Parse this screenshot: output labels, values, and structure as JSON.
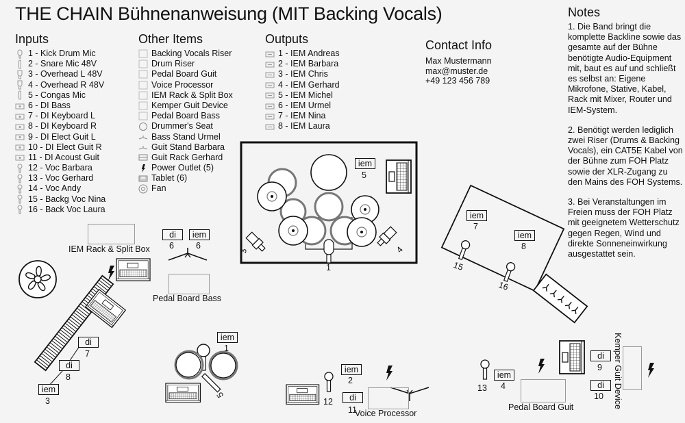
{
  "title": "THE CHAIN Bühnenanweisung (MIT Backing Vocals)",
  "inputs": {
    "heading": "Inputs",
    "items": [
      {
        "label": "1 - Kick Drum Mic",
        "icon": "kick-mic-icon"
      },
      {
        "label": "2 - Snare Mic 48V",
        "icon": "stick-mic-icon"
      },
      {
        "label": "3 - Overhead L 48V",
        "icon": "condenser-mic-icon"
      },
      {
        "label": "4 - Overhead R 48V",
        "icon": "condenser-mic-icon"
      },
      {
        "label": "5 - Congas Mic",
        "icon": "stick-mic-icon"
      },
      {
        "label": "6 - DI Bass",
        "icon": "di-box-icon"
      },
      {
        "label": "7 - DI Keyboard L",
        "icon": "di-box-icon"
      },
      {
        "label": "8 - DI Keyboard R",
        "icon": "di-box-icon"
      },
      {
        "label": "9 - DI Elect Guit L",
        "icon": "di-box-icon"
      },
      {
        "label": "10 - DI Elect Guit R",
        "icon": "di-box-icon"
      },
      {
        "label": "11 - DI Acoust Guit",
        "icon": "di-box-icon"
      },
      {
        "label": "12 - Voc Barbara",
        "icon": "vocal-mic-icon"
      },
      {
        "label": "13 - Voc Gerhard",
        "icon": "vocal-mic-icon"
      },
      {
        "label": "14 - Voc Andy",
        "icon": "vocal-mic-icon"
      },
      {
        "label": "15 - Backg Voc Nina",
        "icon": "vocal-mic-icon"
      },
      {
        "label": "16 - Back Voc Laura",
        "icon": "vocal-mic-icon"
      }
    ]
  },
  "other_items": {
    "heading": "Other Items",
    "items": [
      {
        "label": "Backing Vocals Riser",
        "icon": "riser-icon"
      },
      {
        "label": "Drum Riser",
        "icon": "riser-icon"
      },
      {
        "label": "Pedal Board Guit",
        "icon": "pedal-board-icon"
      },
      {
        "label": "Voice Processor",
        "icon": "processor-icon"
      },
      {
        "label": "IEM Rack & Split Box",
        "icon": "rack-icon"
      },
      {
        "label": "Kemper Guit Device",
        "icon": "kemper-icon"
      },
      {
        "label": "Pedal Board Bass",
        "icon": "pedal-board-icon"
      },
      {
        "label": "Drummer's Seat",
        "icon": "seat-icon"
      },
      {
        "label": "Bass Stand Urmel",
        "icon": "stand-icon"
      },
      {
        "label": "Guit Stand Barbara",
        "icon": "stand-icon"
      },
      {
        "label": "Guit Rack Gerhard",
        "icon": "guitar-rack-icon"
      },
      {
        "label": "Power Outlet (5)",
        "icon": "power-icon"
      },
      {
        "label": "Tablet (6)",
        "icon": "tablet-icon"
      },
      {
        "label": "Fan",
        "icon": "fan-icon"
      }
    ]
  },
  "outputs": {
    "heading": "Outputs",
    "items": [
      {
        "label": "1 - IEM Andreas"
      },
      {
        "label": "2 - IEM Barbara"
      },
      {
        "label": "3 - IEM Chris"
      },
      {
        "label": "4 - IEM Gerhard"
      },
      {
        "label": "5 - IEM Michel"
      },
      {
        "label": "6 - IEM Urmel"
      },
      {
        "label": "7 - IEM Nina"
      },
      {
        "label": "8 - IEM Laura"
      }
    ]
  },
  "contact": {
    "heading": "Contact Info",
    "name": "Max Mustermann",
    "email": "max@muster.de",
    "phone": "+49 123 456 789"
  },
  "notes": {
    "heading": "Notes",
    "items": [
      "1. Die Band bringt die komplette Backline sowie das gesamte auf der Bühne benötigte Audio-Equipment mit, baut es auf und schließt es selbst an: Eigene Mikrofone, Stative, Kabel, Rack mit Mixer, Router und IEM-System.",
      "2. Benötigt werden lediglich zwei Riser (Drums & Backing Vocals), ein CAT5E Kabel von der Bühne zum FOH Platz sowie der XLR-Zugang zu den Mains des FOH Systems.",
      "3. Bei Veranstaltungen im Freien muss der FOH Platz mit geeignetem Wetterschutz gegen Regen, Wind und direkte Sonneneinwirkung ausgestattet sein."
    ]
  },
  "stage": {
    "tags": {
      "di": "di",
      "iem": "iem"
    },
    "labels": {
      "iem_rack": "IEM Rack & Split Box",
      "pedal_bass": "Pedal Board Bass",
      "pedal_guit": "Pedal Board Guit",
      "voice_processor": "Voice Processor",
      "kemper": "Kemper Guit Device"
    },
    "numbers": {
      "kick": "1",
      "oh_l": "3",
      "oh_r": "4",
      "iem5": "5",
      "di6": "6",
      "iem6": "6",
      "di7": "7",
      "di8": "8",
      "iem3": "3",
      "iem1": "1",
      "congas": "5",
      "iem2": "2",
      "di11": "11",
      "voc12": "12",
      "iem7": "7",
      "iem8": "8",
      "voc15": "15",
      "voc16": "16",
      "voc13": "13",
      "iem4": "4",
      "di9": "9",
      "di10": "10"
    }
  }
}
